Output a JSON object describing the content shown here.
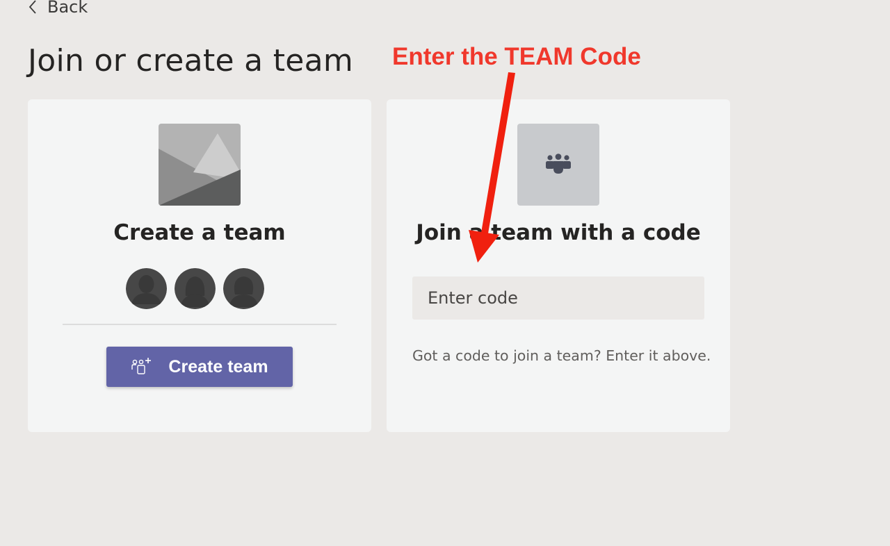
{
  "nav": {
    "back_label": "Back"
  },
  "page": {
    "title": "Join or create a team"
  },
  "annotation": {
    "text": "Enter the TEAM Code",
    "color": "#f0382c"
  },
  "create_card": {
    "title": "Create a team",
    "button_label": "Create team",
    "accent": "#6264a7"
  },
  "join_card": {
    "title": "Join a team with a code",
    "input_placeholder": "Enter code",
    "input_value": "",
    "help_text": "Got a code to join a team? Enter it above."
  },
  "icons": [
    "chevron-left-icon",
    "landscape-placeholder-icon",
    "person-avatar-icon",
    "add-team-icon",
    "team-people-icon",
    "red-arrow-annotation"
  ]
}
